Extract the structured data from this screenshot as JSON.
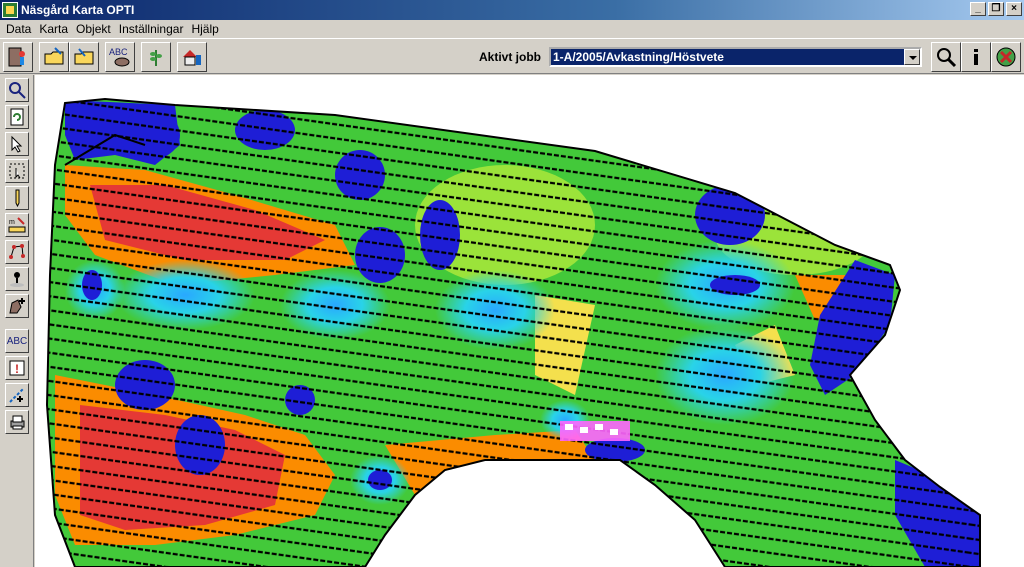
{
  "window": {
    "title": "Näsgård Karta OPTI"
  },
  "menu": [
    {
      "label": "Data",
      "key": "D"
    },
    {
      "label": "Karta",
      "key": "K"
    },
    {
      "label": "Objekt",
      "key": "O"
    },
    {
      "label": "Inställningar",
      "key": "I"
    },
    {
      "label": "Hjälp",
      "key": "H"
    }
  ],
  "toolbar": {
    "jobs_label": "Aktivt jobb",
    "active_job": "1-A/2005/Avkastning/Höstvete",
    "abc_label": "ABC"
  },
  "left_tools": {
    "abc_label": "ABC",
    "exclaim": "!"
  },
  "colors": {
    "title_blue": "#0a246a",
    "zone_red": "#e53935",
    "zone_orange": "#fb8c00",
    "zone_yellow": "#f4e04d",
    "zone_green": "#43c93a",
    "zone_cyan": "#29d3e8",
    "zone_blue": "#1e1ed6",
    "highlight_pink": "#ff66ff"
  }
}
